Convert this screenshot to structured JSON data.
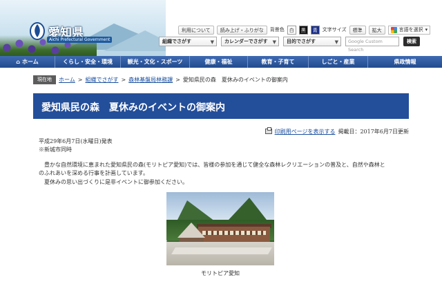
{
  "header": {
    "site_title": "愛知県",
    "site_subtitle": "Aichi Prefectural Government",
    "util": {
      "about": "利用について",
      "read_aloud": "読み上げ・ふりがな",
      "bg_label": "背景色",
      "bg_white": "白",
      "bg_black": "黒",
      "bg_blue": "青",
      "font_size_label": "文字サイズ",
      "font_standard": "標準",
      "font_large": "拡大",
      "language": "言語を選択"
    },
    "nav": {
      "org": "組織でさがす",
      "calendar": "カレンダーでさがす",
      "purpose": "目的でさがす",
      "search_placeholder": "Google Custom Search",
      "search_button": "検索"
    }
  },
  "mainnav": [
    {
      "label": "ホーム",
      "icon": "home-icon"
    },
    {
      "label": "くらし・安全・環境"
    },
    {
      "label": "観光・文化・スポーツ"
    },
    {
      "label": "健康・福祉"
    },
    {
      "label": "教育・子育て"
    },
    {
      "label": "しごと・産業"
    },
    {
      "label": "県政情報"
    }
  ],
  "breadcrumb": {
    "label": "現在地",
    "items": [
      "ホーム",
      "組織でさがす",
      "森林基盤局林務課"
    ],
    "current": "愛知県民の森　夏休みのイベントの御案内"
  },
  "page": {
    "title": "愛知県民の森　夏休みのイベントの御案内",
    "print_link": "印刷用ページを表示する",
    "posted": "掲載日：2017年6月7日更新",
    "date_line": "平成29年6月7日(水曜日)発表",
    "note_line": "※新城市同時",
    "para1": "　豊かな自然環境に恵まれた愛知県民の森(モリトピア愛知)では、皆様の参加を通じて健全な森林レクリエーションの普及と、自然や森林と",
    "para2": "のふれあいを深める行事を計画しています。",
    "para3": "　夏休みの思い出づくりに是非イベントに御参加ください。",
    "photo_caption": "モリトピア愛知"
  }
}
